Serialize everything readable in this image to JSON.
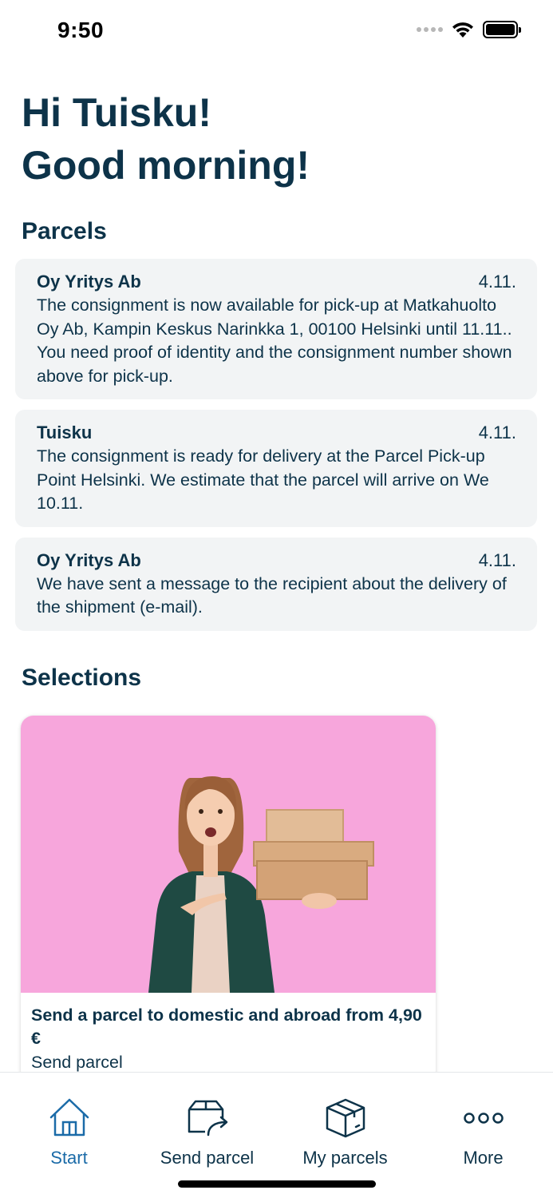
{
  "status_bar": {
    "time": "9:50"
  },
  "greeting": {
    "line1": "Hi Tuisku!",
    "line2": "Good morning!"
  },
  "parcels": {
    "title": "Parcels",
    "items": [
      {
        "sender": "Oy Yritys Ab",
        "date": "4.11.",
        "message": "The consignment is now available for pick-up at Matkahuolto Oy Ab, Kampin Keskus Narinkka 1, 00100 Helsinki until 11.11.. You need proof of identity and the consignment number shown above for pick-up."
      },
      {
        "sender": "Tuisku",
        "date": "4.11.",
        "message": "The consignment is ready for delivery at the Parcel Pick-up Point Helsinki. We estimate that the parcel will arrive on We 10.11."
      },
      {
        "sender": "Oy Yritys Ab",
        "date": "4.11.",
        "message": "We have sent a message to the recipient about the delivery of the shipment (e-mail)."
      }
    ]
  },
  "selections": {
    "title": "Selections",
    "card": {
      "title": "Send a parcel to domestic and abroad from 4,90 €",
      "link": "Send parcel"
    }
  },
  "tab_bar": {
    "tabs": [
      {
        "label": "Start",
        "icon": "home-icon",
        "active": true
      },
      {
        "label": "Send parcel",
        "icon": "send-parcel-icon",
        "active": false
      },
      {
        "label": "My parcels",
        "icon": "box-icon",
        "active": false
      },
      {
        "label": "More",
        "icon": "more-icon",
        "active": false
      }
    ]
  },
  "colors": {
    "primary_text": "#0d3349",
    "active_tab": "#1b6ba8",
    "card_background": "#f2f4f5",
    "selection_image_background": "#f7a6dc"
  }
}
